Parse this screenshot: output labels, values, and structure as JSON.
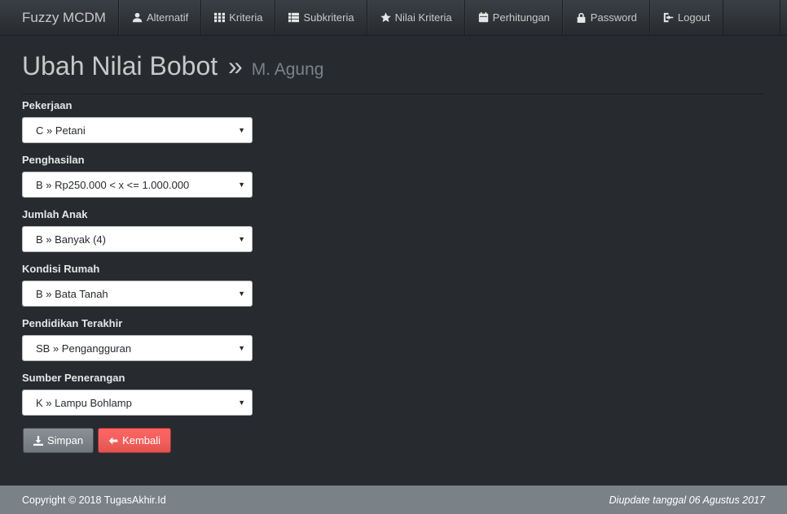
{
  "navbar": {
    "brand": "Fuzzy MCDM",
    "items": [
      {
        "label": "Alternatif",
        "icon": "user-icon"
      },
      {
        "label": "Kriteria",
        "icon": "th-icon"
      },
      {
        "label": "Subkriteria",
        "icon": "th-list-icon"
      },
      {
        "label": "Nilai Kriteria",
        "icon": "star-icon"
      },
      {
        "label": "Perhitungan",
        "icon": "calendar-icon"
      },
      {
        "label": "Password",
        "icon": "lock-icon"
      },
      {
        "label": "Logout",
        "icon": "logout-icon"
      }
    ]
  },
  "header": {
    "title": "Ubah Nilai Bobot",
    "separator": "»",
    "subtitle": "M. Agung"
  },
  "form": {
    "fields": [
      {
        "label": "Pekerjaan",
        "value": "C » Petani"
      },
      {
        "label": "Penghasilan",
        "value": "B » Rp250.000 < x <= 1.000.000"
      },
      {
        "label": "Jumlah Anak",
        "value": "B » Banyak (4)"
      },
      {
        "label": "Kondisi Rumah",
        "value": "B » Bata Tanah"
      },
      {
        "label": "Pendidikan Terakhir",
        "value": "SB » Pengangguran"
      },
      {
        "label": "Sumber Penerangan",
        "value": "K » Lampu Bohlamp"
      }
    ],
    "save_label": "Simpan",
    "back_label": "Kembali"
  },
  "footer": {
    "copyright": "Copyright © 2018 TugasAkhir.Id",
    "updated": "Diupdate tanggal 06 Agustus 2017"
  },
  "colors": {
    "background": "#272b30",
    "navbar": "#3a3f44",
    "footer": "#7a8288",
    "save_button": "#7a8288",
    "back_button": "#ee5f5b"
  }
}
